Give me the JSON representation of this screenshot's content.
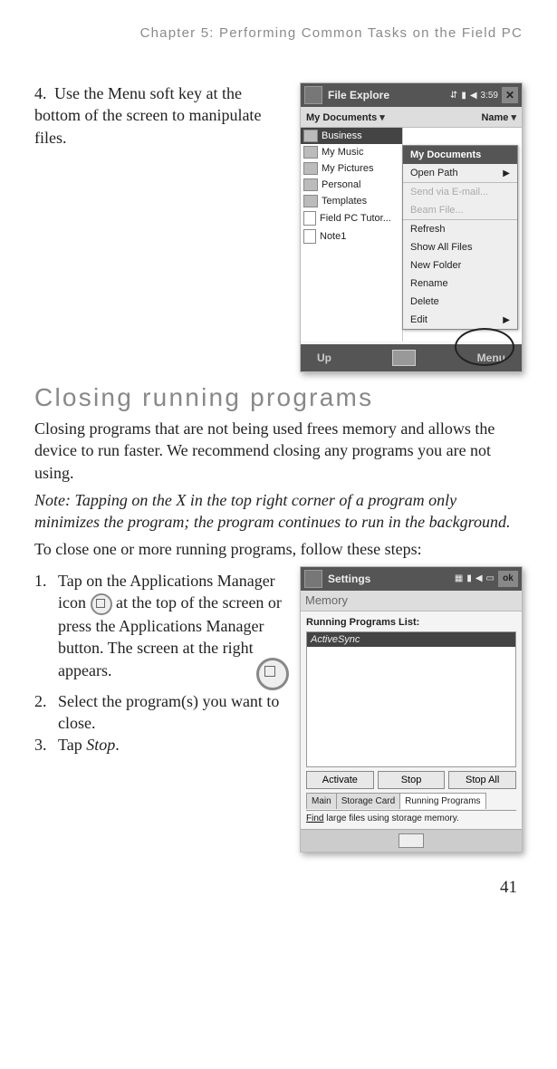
{
  "chapter": "Chapter 5:  Performing Common Tasks on the Field PC",
  "step4": {
    "num": "4.",
    "text": "Use the Menu soft key at the bottom of the screen to manipulate files."
  },
  "fileExplorer": {
    "title": "File Explore",
    "clock": "3:59",
    "headerLeft": "My Documents",
    "headerRight": "Name",
    "items": [
      "Business",
      "My Music",
      "My Pictures",
      "Personal",
      "Templates",
      "Field PC Tutor...",
      "Note1"
    ],
    "menu": {
      "head": "My Documents",
      "openPath": "Open Path",
      "send": "Send via E-mail...",
      "beam": "Beam File...",
      "refresh": "Refresh",
      "showAll": "Show All Files",
      "newFolder": "New Folder",
      "rename": "Rename",
      "delete": "Delete",
      "edit": "Edit"
    },
    "softLeft": "Up",
    "softRight": "Menu"
  },
  "sectionTitle": "Closing running programs",
  "para1": "Closing programs that are not being used frees memory and allows the device to run faster. We recommend closing any programs you are not using.",
  "note": "Note: Tapping on the X in the top right corner of a program only minimizes the program; the program continues to run in the background.",
  "para2": "To close one or more running programs, follow these steps:",
  "steps": {
    "s1num": "1.",
    "s1a": "Tap on the Applications Manager icon ",
    "s1b": " at the top of the screen or press the Applications Manager button. The screen at the right appears.",
    "s2num": "2.",
    "s2": "Select the program(s) you want to close.",
    "s3num": "3.",
    "s3a": "Tap ",
    "s3b": "Stop",
    "s3c": "."
  },
  "memory": {
    "appTitle": "Settings",
    "panel": "Memory",
    "listLabel": "Running Programs List:",
    "selected": "ActiveSync",
    "btnActivate": "Activate",
    "btnStop": "Stop",
    "btnStopAll": "Stop All",
    "tabMain": "Main",
    "tabStorage": "Storage Card",
    "tabRunning": "Running Programs",
    "findText1": "Find",
    "findText2": " large files using storage memory."
  },
  "pageNumber": "41"
}
